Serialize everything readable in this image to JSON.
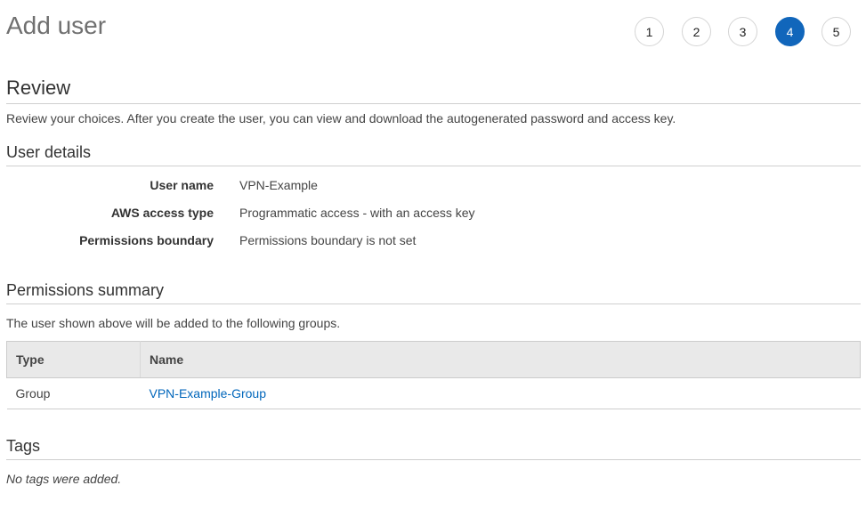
{
  "header": {
    "title": "Add user"
  },
  "steps": [
    {
      "label": "1",
      "active": false
    },
    {
      "label": "2",
      "active": false
    },
    {
      "label": "3",
      "active": false
    },
    {
      "label": "4",
      "active": true
    },
    {
      "label": "5",
      "active": false
    }
  ],
  "review": {
    "title": "Review",
    "description": "Review your choices. After you create the user, you can view and download the autogenerated password and access key."
  },
  "user_details": {
    "title": "User details",
    "rows": [
      {
        "label": "User name",
        "value": "VPN-Example"
      },
      {
        "label": "AWS access type",
        "value": "Programmatic access - with an access key"
      },
      {
        "label": "Permissions boundary",
        "value": "Permissions boundary is not set"
      }
    ]
  },
  "permissions": {
    "title": "Permissions summary",
    "description": "The user shown above will be added to the following groups.",
    "columns": [
      "Type",
      "Name"
    ],
    "rows": [
      {
        "type": "Group",
        "name": "VPN-Example-Group"
      }
    ]
  },
  "tags": {
    "title": "Tags",
    "empty_text": "No tags were added."
  },
  "colors": {
    "accent": "#1166bb",
    "link": "#0066bb"
  }
}
